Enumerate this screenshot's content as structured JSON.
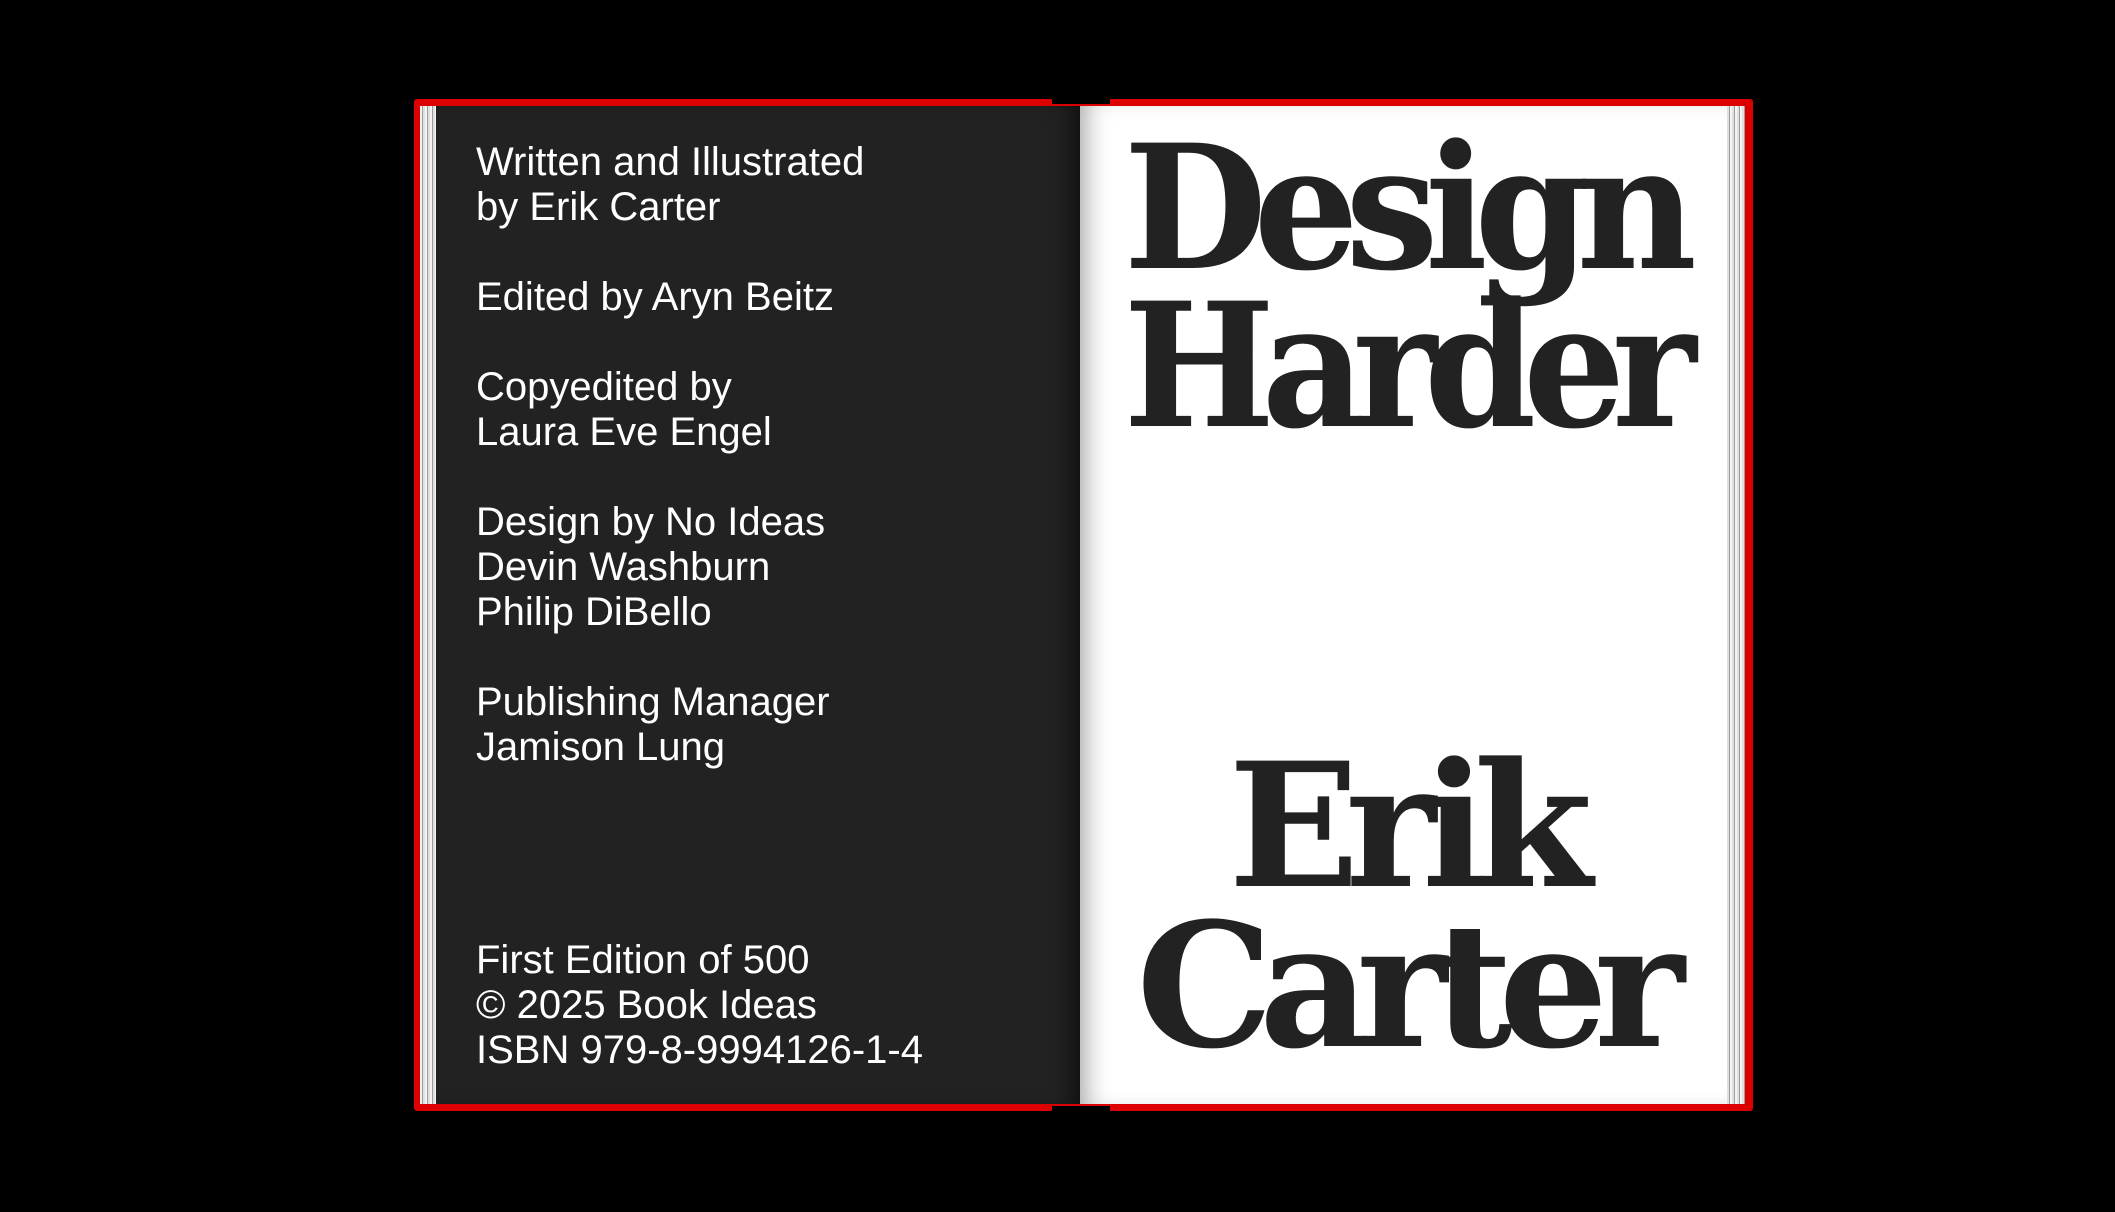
{
  "left_page": {
    "credits": [
      {
        "text": "Written and Illustrated\nby Erik Carter"
      },
      {
        "text": "Edited by Aryn Beitz"
      },
      {
        "text": "Copyedited by\nLaura Eve Engel"
      },
      {
        "text": "Design by No Ideas\nDevin Washburn\nPhilip DiBello"
      },
      {
        "text": "Publishing Manager\nJamison Lung"
      }
    ],
    "edition": "First Edition of 500\n© 2025 Book Ideas\nISBN 979-8-9994126-1-4"
  },
  "right_page": {
    "title_line_1": "Design",
    "title_line_2": "Harder",
    "author_line_1": "Erik",
    "author_line_2": "Carter"
  },
  "colors": {
    "cover": "#dd0000",
    "left_page_bg": "#222222",
    "right_page_bg": "#ffffff",
    "text_light": "#ffffff",
    "text_dark": "#222222"
  }
}
